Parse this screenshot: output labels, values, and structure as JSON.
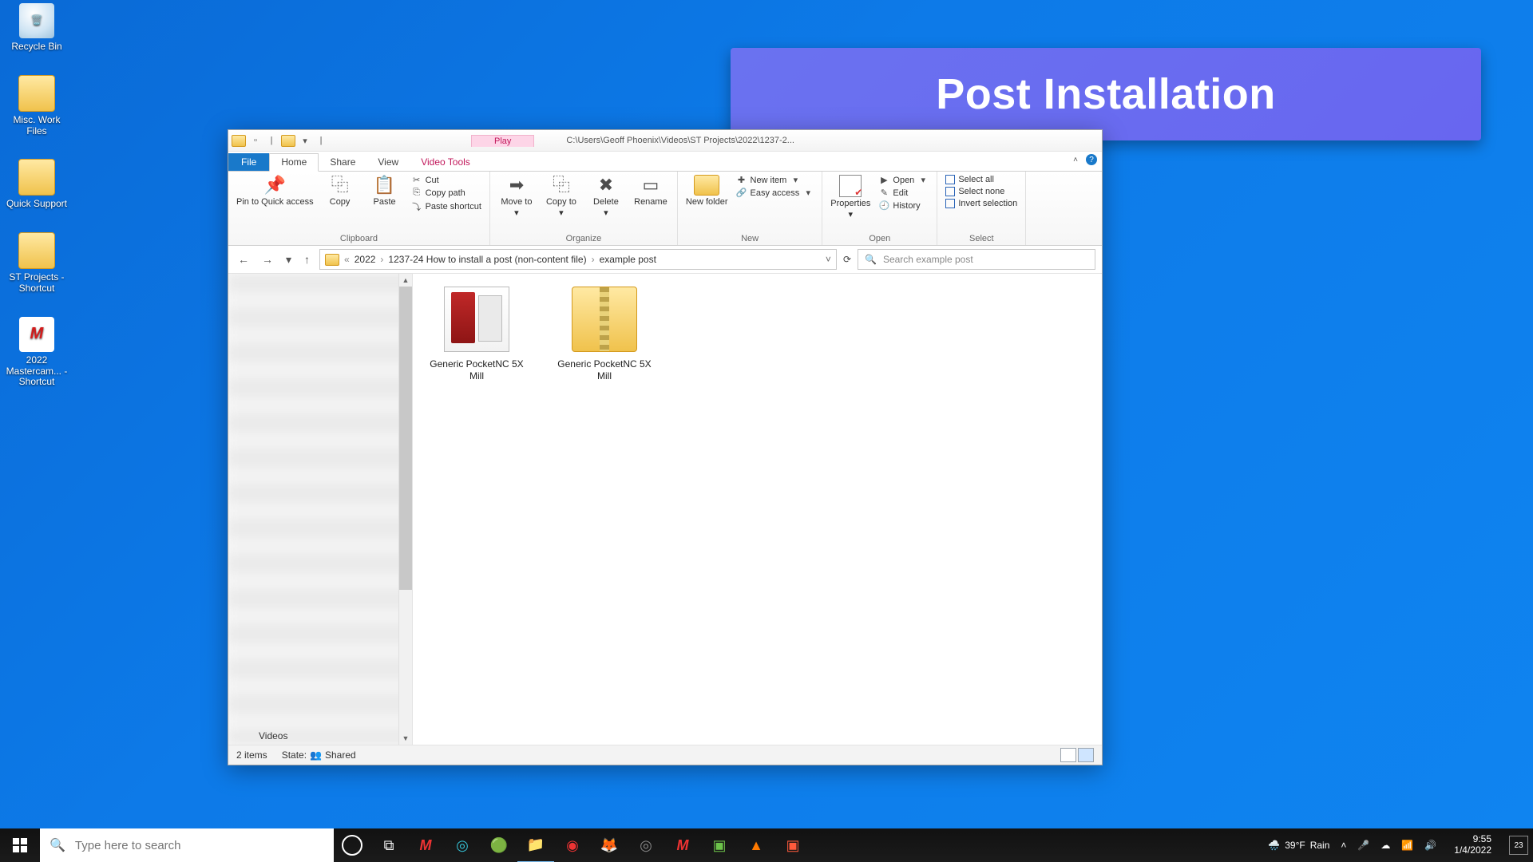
{
  "banner": {
    "text": "Post Installation"
  },
  "desktop": {
    "icons": [
      {
        "label": "Recycle Bin"
      },
      {
        "label": "Misc. Work Files"
      },
      {
        "label": "Quick Support"
      },
      {
        "label": "ST Projects - Shortcut"
      },
      {
        "label": "2022 Mastercam... - Shortcut"
      }
    ]
  },
  "explorer": {
    "title_path": "C:\\Users\\Geoff Phoenix\\Videos\\ST Projects\\2022\\1237-2...",
    "tools_tab": "Play",
    "tools_group": "Video Tools",
    "tabs": {
      "file": "File",
      "home": "Home",
      "share": "Share",
      "view": "View"
    },
    "ribbon": {
      "clipboard": {
        "label": "Clipboard",
        "pin": "Pin to Quick access",
        "copy": "Copy",
        "paste": "Paste",
        "cut": "Cut",
        "copy_path": "Copy path",
        "paste_shortcut": "Paste shortcut"
      },
      "organize": {
        "label": "Organize",
        "move_to": "Move to",
        "copy_to": "Copy to",
        "delete": "Delete",
        "rename": "Rename"
      },
      "new": {
        "label": "New",
        "new_folder": "New folder",
        "new_item": "New item",
        "easy_access": "Easy access"
      },
      "open": {
        "label": "Open",
        "properties": "Properties",
        "open": "Open",
        "edit": "Edit",
        "history": "History"
      },
      "select": {
        "label": "Select",
        "select_all": "Select all",
        "select_none": "Select none",
        "invert": "Invert selection"
      }
    },
    "address": {
      "segments": [
        "«",
        "2022",
        "1237-24 How to install a post (non-content file)",
        "example post"
      ]
    },
    "search": {
      "placeholder": "Search example post"
    },
    "navpane_bottom": "Videos",
    "items": [
      {
        "name": "Generic PocketNC 5X Mill",
        "kind": "book"
      },
      {
        "name": "Generic PocketNC 5X Mill",
        "kind": "zip"
      }
    ],
    "status": {
      "count": "2 items",
      "state_label": "State:",
      "state_value": "Shared"
    }
  },
  "taskbar": {
    "search_placeholder": "Type here to search",
    "weather": {
      "temp": "39°F",
      "cond": "Rain"
    },
    "clock": {
      "time": "9:55",
      "date": "1/4/2022"
    },
    "notifications": "23"
  }
}
